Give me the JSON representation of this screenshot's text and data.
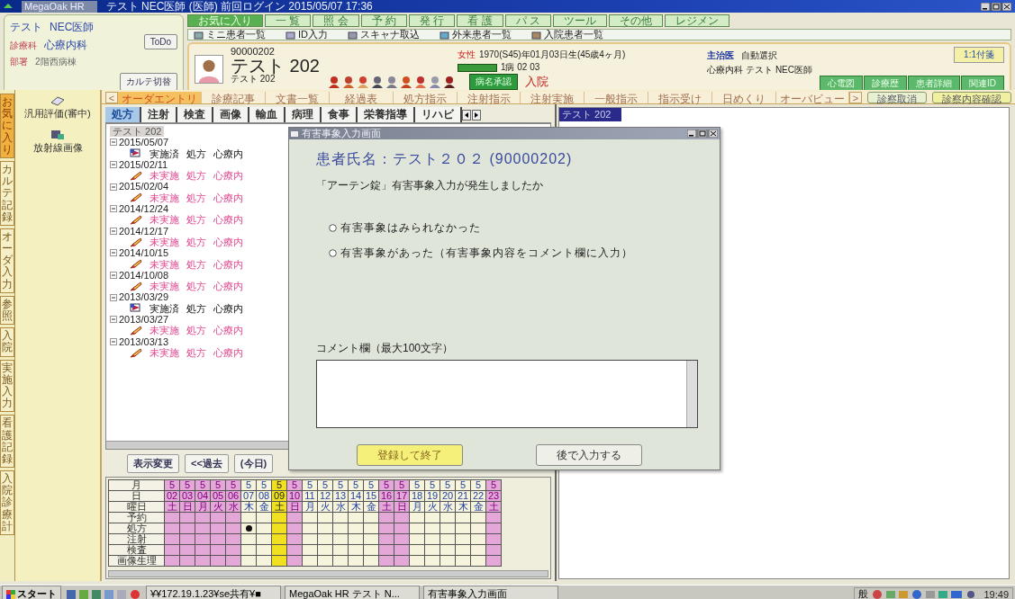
{
  "window": {
    "app": "MegaOak HR",
    "title": "テスト NEC医師 (医師) 前回ログイン 2015/05/07 17:36"
  },
  "user": {
    "name": "テスト",
    "role": "NEC医師",
    "dept_label": "診療科",
    "dept": "心療内科",
    "ward_label": "部署",
    "ward": "2階西病棟"
  },
  "user_buttons": [
    "ToDo",
    "カルテ切替"
  ],
  "menu": [
    {
      "label": "お気に入り",
      "selected": true
    },
    {
      "label": "一 覧",
      "selected": false
    },
    {
      "label": "照 会",
      "selected": false
    },
    {
      "label": "予 約",
      "selected": false
    },
    {
      "label": "発 行",
      "selected": false
    },
    {
      "label": "看 護",
      "selected": false
    },
    {
      "label": "パ ス",
      "selected": false
    },
    {
      "label": "ツール",
      "selected": false
    },
    {
      "label": "その他",
      "selected": false
    },
    {
      "label": "レジメン",
      "selected": false
    }
  ],
  "toolbar": [
    "ミニ患者一覧",
    "ID入力",
    "スキャナ取込",
    "外来患者一覧",
    "入院患者一覧"
  ],
  "patient": {
    "id": "90000202",
    "sex": "女性",
    "birth": "1970(S45)年01月03日生(45歳4ヶ月)",
    "name": "テスト 202",
    "kana": "テスト 202",
    "room": "1病 02 03",
    "approval": "病名承認",
    "status": "入院",
    "doctor_label": "主治医",
    "doctor_mode": "自動選択",
    "doctor": "心療内科 テスト NEC医師",
    "note_button": "1:1付箋",
    "tabs": [
      "心電図",
      "診療歴",
      "患者詳細",
      "関連ID"
    ]
  },
  "order_tabs": [
    {
      "label": "オーダエントリ",
      "selected": true
    },
    {
      "label": "診療記事",
      "selected": false
    },
    {
      "label": "文書一覧",
      "selected": false
    },
    {
      "label": "経過表",
      "selected": false
    },
    {
      "label": "処方指示",
      "selected": false
    },
    {
      "label": "注射指示",
      "selected": false
    },
    {
      "label": "注射実施",
      "selected": false
    },
    {
      "label": "一般指示",
      "selected": false
    },
    {
      "label": "指示受け",
      "selected": false
    },
    {
      "label": "日めくり",
      "selected": false
    },
    {
      "label": "オーバビュー",
      "selected": false
    }
  ],
  "order_scroll": [
    "<",
    ">"
  ],
  "order_actions": [
    "診察取消",
    "診察内容確認"
  ],
  "side_tabs": [
    {
      "label": "お気に入り",
      "selected": true
    },
    {
      "label": "カルテ記録",
      "selected": false
    },
    {
      "label": "オーダ入力",
      "selected": false
    },
    {
      "label": "参照",
      "selected": false
    },
    {
      "label": "入院",
      "selected": false
    },
    {
      "label": "実施入力",
      "selected": false
    },
    {
      "label": "看護記録",
      "selected": false
    },
    {
      "label": "入院診療計",
      "selected": false
    }
  ],
  "side_items": [
    "汎用評価(審中)",
    "放射線画像"
  ],
  "categories": [
    {
      "label": "処方",
      "selected": true
    },
    {
      "label": "注射",
      "selected": false
    },
    {
      "label": "検査",
      "selected": false
    },
    {
      "label": "画像",
      "selected": false
    },
    {
      "label": "輸血",
      "selected": false
    },
    {
      "label": "病理",
      "selected": false
    },
    {
      "label": "食事",
      "selected": false
    },
    {
      "label": "栄養指導",
      "selected": false
    },
    {
      "label": "リハビ",
      "selected": false
    }
  ],
  "tree": {
    "root": "テスト 202",
    "children": [
      {
        "date": "2015/05/07",
        "expanded": true,
        "children": [
          {
            "status": "実施済",
            "done": true,
            "type": "処方",
            "dept": "心療内"
          }
        ]
      },
      {
        "date": "2015/02/11",
        "expanded": true,
        "children": [
          {
            "status": "未実施",
            "done": false,
            "type": "処方",
            "dept": "心療内"
          }
        ]
      },
      {
        "date": "2015/02/04",
        "expanded": true,
        "children": [
          {
            "status": "未実施",
            "done": false,
            "type": "処方",
            "dept": "心療内"
          }
        ]
      },
      {
        "date": "2014/12/24",
        "expanded": true,
        "children": [
          {
            "status": "未実施",
            "done": false,
            "type": "処方",
            "dept": "心療内"
          }
        ]
      },
      {
        "date": "2014/12/17",
        "expanded": true,
        "children": [
          {
            "status": "未実施",
            "done": false,
            "type": "処方",
            "dept": "心療内"
          }
        ]
      },
      {
        "date": "2014/10/15",
        "expanded": true,
        "children": [
          {
            "status": "未実施",
            "done": false,
            "type": "処方",
            "dept": "心療内"
          }
        ]
      },
      {
        "date": "2014/10/08",
        "expanded": true,
        "children": [
          {
            "status": "未実施",
            "done": false,
            "type": "処方",
            "dept": "心療内"
          }
        ]
      },
      {
        "date": "2013/03/29",
        "expanded": true,
        "children": [
          {
            "status": "実施済",
            "done": true,
            "type": "処方",
            "dept": "心療内"
          }
        ]
      },
      {
        "date": "2013/03/27",
        "expanded": true,
        "children": [
          {
            "status": "未実施",
            "done": false,
            "type": "処方",
            "dept": "心療内"
          }
        ]
      },
      {
        "date": "2013/03/13",
        "expanded": true,
        "children": [
          {
            "status": "未実施",
            "done": false,
            "type": "処方",
            "dept": "心療内"
          }
        ]
      }
    ]
  },
  "nav_buttons": [
    "表示変更",
    "<<過去",
    "(今日)"
  ],
  "calendar": {
    "row_labels": [
      "月",
      "日",
      "曜日",
      "予約",
      "処方",
      "注射",
      "検査",
      "画像生理"
    ],
    "days": [
      {
        "month": "5",
        "day": "02",
        "weekday": "土",
        "kind": "holiday",
        "dot": false
      },
      {
        "month": "5",
        "day": "03",
        "weekday": "日",
        "kind": "holiday",
        "dot": false
      },
      {
        "month": "5",
        "day": "04",
        "weekday": "月",
        "kind": "holiday",
        "dot": false
      },
      {
        "month": "5",
        "day": "05",
        "weekday": "火",
        "kind": "holiday",
        "dot": false
      },
      {
        "month": "5",
        "day": "06",
        "weekday": "水",
        "kind": "holiday",
        "dot": false
      },
      {
        "month": "5",
        "day": "07",
        "weekday": "木",
        "kind": "plain",
        "dot": true
      },
      {
        "month": "5",
        "day": "08",
        "weekday": "金",
        "kind": "plain",
        "dot": false
      },
      {
        "month": "5",
        "day": "09",
        "weekday": "土",
        "kind": "today",
        "dot": false
      },
      {
        "month": "5",
        "day": "10",
        "weekday": "日",
        "kind": "holiday",
        "dot": false
      },
      {
        "month": "5",
        "day": "11",
        "weekday": "月",
        "kind": "plain",
        "dot": false
      },
      {
        "month": "5",
        "day": "12",
        "weekday": "火",
        "kind": "plain",
        "dot": false
      },
      {
        "month": "5",
        "day": "13",
        "weekday": "水",
        "kind": "plain",
        "dot": false
      },
      {
        "month": "5",
        "day": "14",
        "weekday": "木",
        "kind": "plain",
        "dot": false
      },
      {
        "month": "5",
        "day": "15",
        "weekday": "金",
        "kind": "plain",
        "dot": false
      },
      {
        "month": "5",
        "day": "16",
        "weekday": "土",
        "kind": "holiday",
        "dot": false
      },
      {
        "month": "5",
        "day": "17",
        "weekday": "日",
        "kind": "holiday",
        "dot": false
      },
      {
        "month": "5",
        "day": "18",
        "weekday": "月",
        "kind": "plain",
        "dot": false
      },
      {
        "month": "5",
        "day": "19",
        "weekday": "火",
        "kind": "plain",
        "dot": false
      },
      {
        "month": "5",
        "day": "20",
        "weekday": "水",
        "kind": "plain",
        "dot": false
      },
      {
        "month": "5",
        "day": "21",
        "weekday": "木",
        "kind": "plain",
        "dot": false
      },
      {
        "month": "5",
        "day": "22",
        "weekday": "金",
        "kind": "plain",
        "dot": false
      },
      {
        "month": "5",
        "day": "23",
        "weekday": "土",
        "kind": "holiday",
        "dot": false
      }
    ]
  },
  "right_panel": {
    "title": "テスト 202"
  },
  "dialog": {
    "title": "有害事象入力画面",
    "patient": "患者氏名：テスト２０２ (90000202)",
    "question": "「アーテン錠」有害事象入力が発生しましたか",
    "options": [
      {
        "label": "有害事象はみられなかった",
        "selected": false
      },
      {
        "label": "有害事象があった（有害事象内容をコメント欄に入力）",
        "selected": false
      }
    ],
    "comment_label": "コメント欄（最大100文字）",
    "buttons": [
      {
        "label": "登録して終了",
        "kind": "primary"
      },
      {
        "label": "後で入力する",
        "kind": "normal"
      }
    ]
  },
  "taskbar": {
    "start": "スタート",
    "tasks": [
      "¥¥172.19.1.23¥se共有¥■",
      "MegaOak HR テスト N...",
      "有害事象入力画面"
    ],
    "ime": "般",
    "clock": "19:49"
  }
}
